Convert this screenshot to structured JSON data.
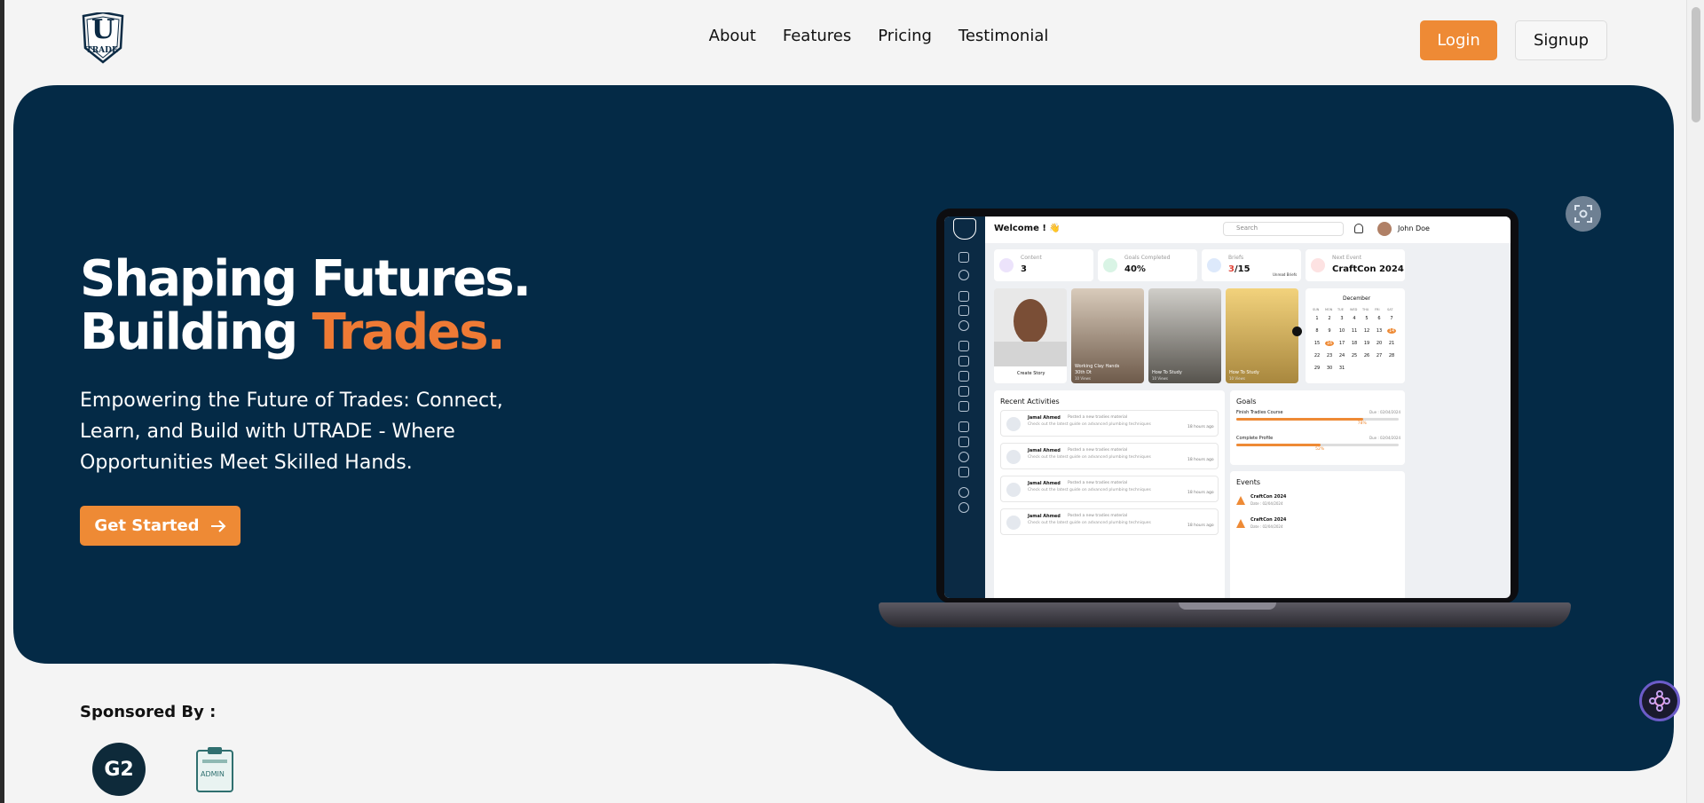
{
  "brand": {
    "logo_letter": "U",
    "logo_word": "TRADE"
  },
  "nav": {
    "items": [
      "About",
      "Features",
      "Pricing",
      "Testimonial"
    ]
  },
  "auth": {
    "login": "Login",
    "signup": "Signup"
  },
  "hero": {
    "title_line1": "Shaping Futures.",
    "title_line2_plain": "Building ",
    "title_line2_accent": "Trades.",
    "subtitle": "Empowering the Future of Trades: Connect, Learn, and Build with UTRADE - Where Opportunities Meet Skilled Hands.",
    "cta": "Get Started"
  },
  "sponsors": {
    "title": "Sponsored By :",
    "g2": "G2",
    "clipboard": "ADMIN"
  },
  "colors": {
    "navy": "#042a46",
    "accent": "#ee8a35"
  },
  "dashboard": {
    "welcome": "Welcome ! 👋",
    "search_placeholder": "Search",
    "user": "John Doe",
    "stats": [
      {
        "label": "Content",
        "value": "3"
      },
      {
        "label": "Goals Completed",
        "value": "40%"
      },
      {
        "label": "Briefs",
        "value_a": "3",
        "value_b": "/15",
        "tag": "Unread Briefs"
      },
      {
        "label": "Next Event",
        "value": "CraftCon 2024"
      }
    ],
    "stories": [
      {
        "caption": "Create Story"
      },
      {
        "caption": "Working Clay Hands",
        "sub": "30th Dt",
        "views": "10 Views"
      },
      {
        "caption": "How To Study",
        "views": "10 Views"
      },
      {
        "caption": "How To Study",
        "views": "10 Views"
      }
    ],
    "calendar": {
      "month": "December",
      "days": [
        "SUN",
        "MON",
        "TUE",
        "WED",
        "THU",
        "FRI",
        "SAT"
      ],
      "weeks": [
        [
          "1",
          "2",
          "3",
          "4",
          "5",
          "6",
          "7"
        ],
        [
          "8",
          "9",
          "10",
          "11",
          "12",
          "13",
          "14"
        ],
        [
          "15",
          "16",
          "17",
          "18",
          "19",
          "20",
          "21"
        ],
        [
          "22",
          "23",
          "24",
          "25",
          "26",
          "27",
          "28"
        ],
        [
          "29",
          "30",
          "31",
          "",
          "",
          "",
          ""
        ]
      ]
    },
    "activities_title": "Recent Activities",
    "activities": [
      {
        "name": "Jamal Ahmed",
        "action": "Posted a new tradies material",
        "detail": "Check out the latest guide on advanced plumbing techniques",
        "time": "18 hours ago"
      },
      {
        "name": "Jamal Ahmed",
        "action": "Posted a new tradies material",
        "detail": "Check out the latest guide on advanced plumbing techniques",
        "time": "18 hours ago"
      },
      {
        "name": "Jamal Ahmed",
        "action": "Posted a new tradies material",
        "detail": "Check out the latest guide on advanced plumbing techniques",
        "time": "18 hours ago"
      },
      {
        "name": "Jamal Ahmed",
        "action": "Posted a new tradies material",
        "detail": "Check out the latest guide on advanced plumbing techniques",
        "time": "18 hours ago"
      }
    ],
    "goals_title": "Goals",
    "goals": [
      {
        "name": "Finish Tradies Course",
        "due": "Due : 02/04/2024",
        "progress": 0.78,
        "label": "78%"
      },
      {
        "name": "Complete Profile",
        "due": "Due : 02/04/2024",
        "progress": 0.52,
        "label": "52%"
      }
    ],
    "events_title": "Events",
    "events": [
      {
        "name": "CraftCon 2024",
        "date": "Date : 02/04/2024"
      },
      {
        "name": "CraftCon 2024",
        "date": "Date : 02/04/2024"
      }
    ]
  }
}
